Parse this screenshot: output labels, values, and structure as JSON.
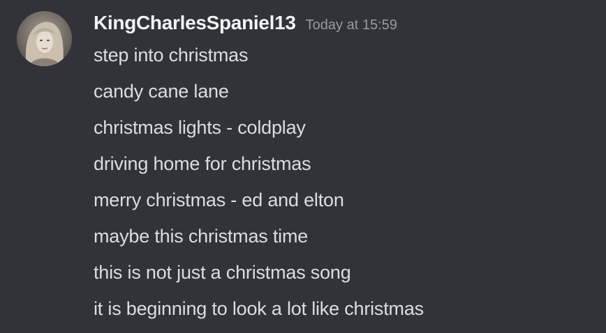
{
  "author": {
    "username": "KingCharlesSpaniel13",
    "timestamp": "Today at 15:59",
    "avatar_icon": "user-avatar-photo"
  },
  "colors": {
    "background": "#313338",
    "username": "#f2f3f5",
    "timestamp": "#949ba4",
    "message_text": "#dbdee1"
  },
  "messages": [
    "step into christmas",
    "candy cane lane",
    "christmas lights - coldplay",
    "driving home for christmas",
    "merry christmas - ed and elton",
    "maybe this christmas time",
    "this is not just a christmas song",
    "it is beginning to look a lot like christmas"
  ]
}
